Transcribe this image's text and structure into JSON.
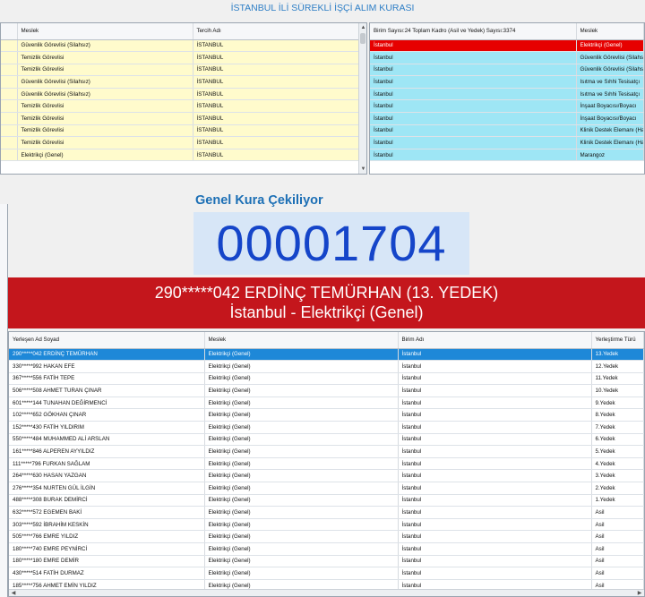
{
  "title": "İSTANBUL İLİ SÜREKLİ İŞÇİ ALIM KURASI",
  "left_table": {
    "columns": [
      "Meslek",
      "Tercih Adı"
    ],
    "rows": [
      [
        "Güvenlik Görevlisi (Silahsız)",
        "İSTANBUL"
      ],
      [
        "Temizlik Görevlisi",
        "İSTANBUL"
      ],
      [
        "Temizlik Görevlisi",
        "İSTANBUL"
      ],
      [
        "Güvenlik Görevlisi (Silahsız)",
        "İSTANBUL"
      ],
      [
        "Güvenlik Görevlisi (Silahsız)",
        "İSTANBUL"
      ],
      [
        "Temizlik Görevlisi",
        "İSTANBUL"
      ],
      [
        "Temizlik Görevlisi",
        "İSTANBUL"
      ],
      [
        "Temizlik Görevlisi",
        "İSTANBUL"
      ],
      [
        "Temizlik Görevlisi",
        "İSTANBUL"
      ],
      [
        "Elektrikçi (Genel)",
        "İSTANBUL"
      ]
    ]
  },
  "right_table": {
    "columns": [
      "Birim Sayısı:24 Toplam Kadro (Asil ve Yedek) Sayısı:3374",
      "Meslek"
    ],
    "rows": [
      [
        "İstanbul",
        "Elektrikçi (Genel)"
      ],
      [
        "İstanbul",
        "Güvenlik Görevlisi (Silahsız)"
      ],
      [
        "İstanbul",
        "Güvenlik Görevlisi (Silahsız)"
      ],
      [
        "İstanbul",
        "Isıtma ve Sıhhi Tesisatçı"
      ],
      [
        "İstanbul",
        "Isıtma ve Sıhhi Tesisatçı"
      ],
      [
        "İstanbul",
        "İnşaat Boyacısı/Boyacı"
      ],
      [
        "İstanbul",
        "İnşaat Boyacısı/Boyacı"
      ],
      [
        "İstanbul",
        "Klinik Destek Elemanı (Hasta)"
      ],
      [
        "İstanbul",
        "Klinik Destek Elemanı (Hasta)"
      ],
      [
        "İstanbul",
        "Marangoz"
      ]
    ]
  },
  "draw_heading": "Genel Kura Çekiliyor",
  "counter": "00001704",
  "banner": {
    "line1": "290*****042 ERDİNÇ TEMÜRHAN (13. YEDEK)",
    "line2": "İstanbul - Elektrikçi (Genel)"
  },
  "bottom_table": {
    "columns": [
      "Yerleşen Ad Soyad",
      "Meslek",
      "Birim Adı",
      "Yerleştirme Türü"
    ],
    "rows": [
      [
        "290*****042 ERDİNÇ TEMÜRHAN",
        "Elektrikçi (Genel)",
        "İstanbul",
        "13.Yedek"
      ],
      [
        "330*****992 HAKAN EFE",
        "Elektrikçi (Genel)",
        "İstanbul",
        "12.Yedek"
      ],
      [
        "367*****556 FATİH TEPE",
        "Elektrikçi (Genel)",
        "İstanbul",
        "11.Yedek"
      ],
      [
        "506*****508 AHMET TURAN ÇINAR",
        "Elektrikçi (Genel)",
        "İstanbul",
        "10.Yedek"
      ],
      [
        "601*****144 TUNAHAN DEĞİRMENCİ",
        "Elektrikçi (Genel)",
        "İstanbul",
        "9.Yedek"
      ],
      [
        "102*****652 GÖKHAN ÇINAR",
        "Elektrikçi (Genel)",
        "İstanbul",
        "8.Yedek"
      ],
      [
        "152*****430 FATİH YILDIRIM",
        "Elektrikçi (Genel)",
        "İstanbul",
        "7.Yedek"
      ],
      [
        "550*****484 MUHAMMED ALİ ARSLAN",
        "Elektrikçi (Genel)",
        "İstanbul",
        "6.Yedek"
      ],
      [
        "161*****846 ALPEREN AYYILDIZ",
        "Elektrikçi (Genel)",
        "İstanbul",
        "5.Yedek"
      ],
      [
        "111*****796 FURKAN SAĞLAM",
        "Elektrikçi (Genel)",
        "İstanbul",
        "4.Yedek"
      ],
      [
        "264*****630 HASAN YAZGAN",
        "Elektrikçi (Genel)",
        "İstanbul",
        "3.Yedek"
      ],
      [
        "276*****354 NURTEN GÜL İLGİN",
        "Elektrikçi (Genel)",
        "İstanbul",
        "2.Yedek"
      ],
      [
        "488*****308 BURAK DEMİRCİ",
        "Elektrikçi (Genel)",
        "İstanbul",
        "1.Yedek"
      ],
      [
        "632*****572 EGEMEN BAKİ",
        "Elektrikçi (Genel)",
        "İstanbul",
        "Asil"
      ],
      [
        "303*****592 İBRAHİM KESKİN",
        "Elektrikçi (Genel)",
        "İstanbul",
        "Asil"
      ],
      [
        "505*****766 EMRE YILDIZ",
        "Elektrikçi (Genel)",
        "İstanbul",
        "Asil"
      ],
      [
        "180*****740 EMRE PEYNİRCİ",
        "Elektrikçi (Genel)",
        "İstanbul",
        "Asil"
      ],
      [
        "180*****180 EMRE DEMİR",
        "Elektrikçi (Genel)",
        "İstanbul",
        "Asil"
      ],
      [
        "430*****514 FATİH DURMAZ",
        "Elektrikçi (Genel)",
        "İstanbul",
        "Asil"
      ],
      [
        "185*****756 AHMET EMİN YILDIZ",
        "Elektrikçi (Genel)",
        "İstanbul",
        "Asil"
      ]
    ]
  }
}
